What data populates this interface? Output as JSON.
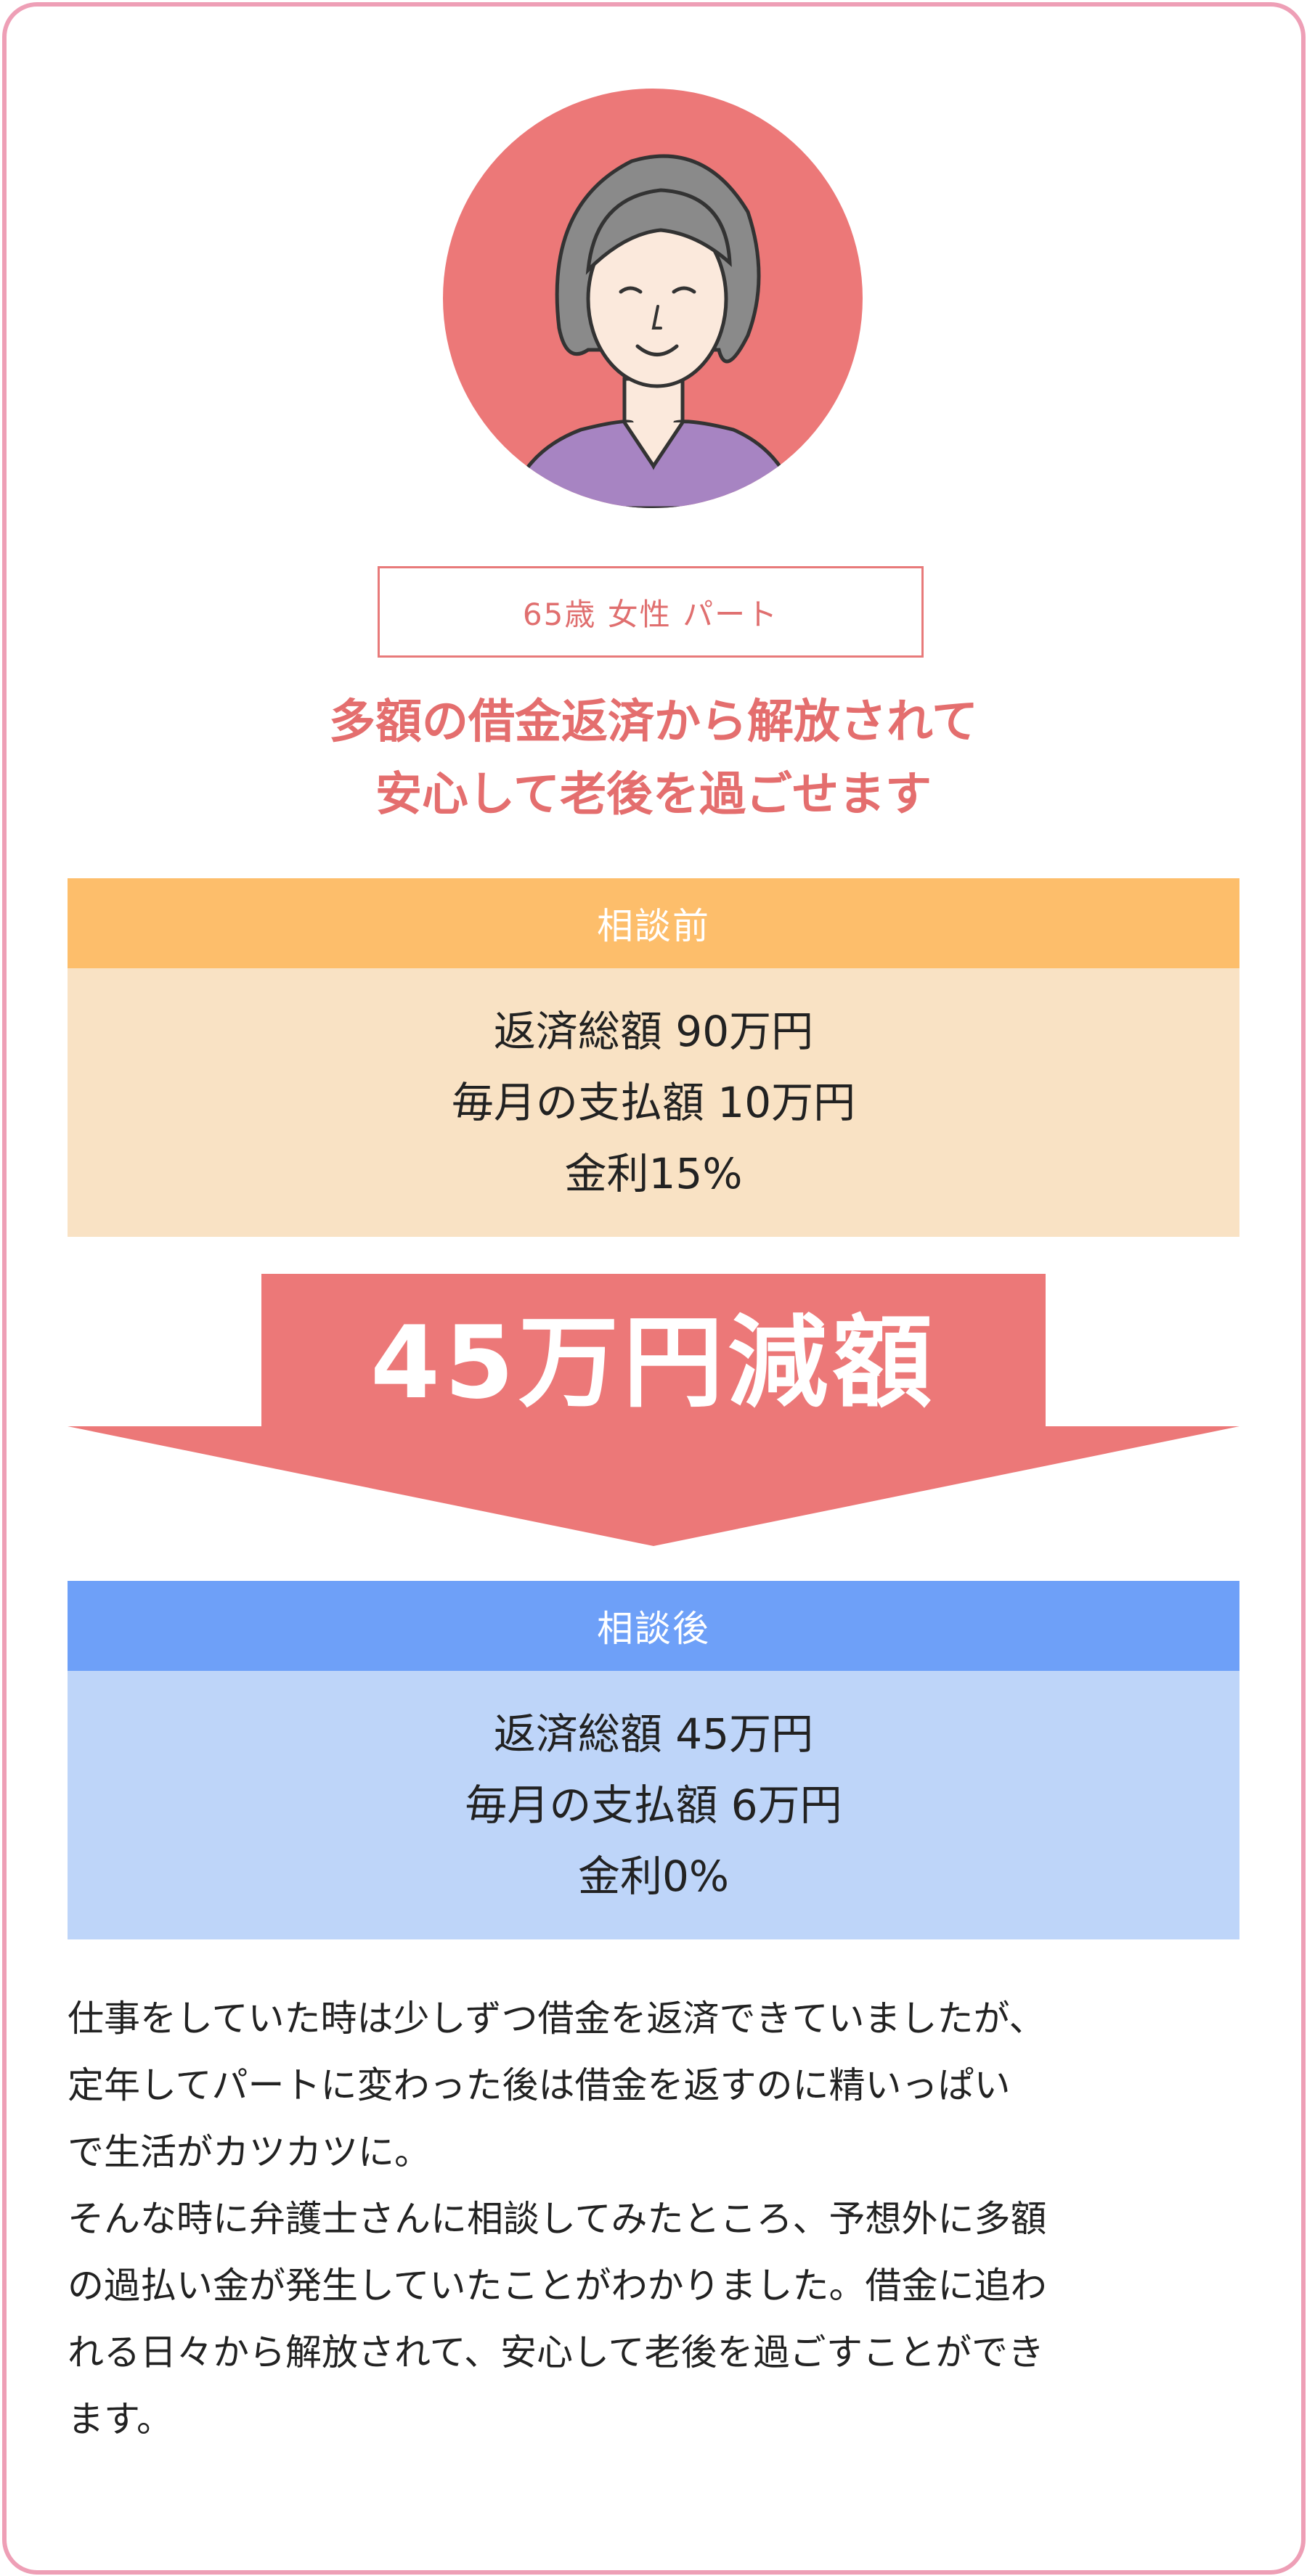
{
  "colors": {
    "frame": "#ee9fb6",
    "accent": "#e46e6e",
    "before_header": "#fdbe6b",
    "before_body": "#f9e2c4",
    "after_header": "#6ea0f8",
    "after_body": "#bed5f9",
    "arrow": "#ec7878"
  },
  "profile": {
    "avatar": "elderly-woman-illustration",
    "tag": "65歳 女性 パート"
  },
  "headline": {
    "line1": "多額の借金返済から解放されて",
    "line2": "安心して老後を過ごせます"
  },
  "before": {
    "label": "相談前",
    "lines": [
      "返済総額 90万円",
      "毎月の支払額 10万円",
      "金利15%"
    ]
  },
  "reduction": {
    "label": "45万円減額"
  },
  "after": {
    "label": "相談後",
    "lines": [
      "返済総額 45万円",
      "毎月の支払額 6万円",
      "金利0%"
    ]
  },
  "story": {
    "lines": [
      "仕事をしていた時は少しずつ借金を返済できていましたが、",
      "定年してパートに変わった後は借金を返すのに精いっぱい",
      "で生活がカツカツに。",
      "そんな時に弁護士さんに相談してみたところ、予想外に多額",
      "の過払い金が発生していたことがわかりました。借金に追わ",
      "れる日々から解放されて、安心して老後を過ごすことができ",
      "ます。"
    ]
  }
}
